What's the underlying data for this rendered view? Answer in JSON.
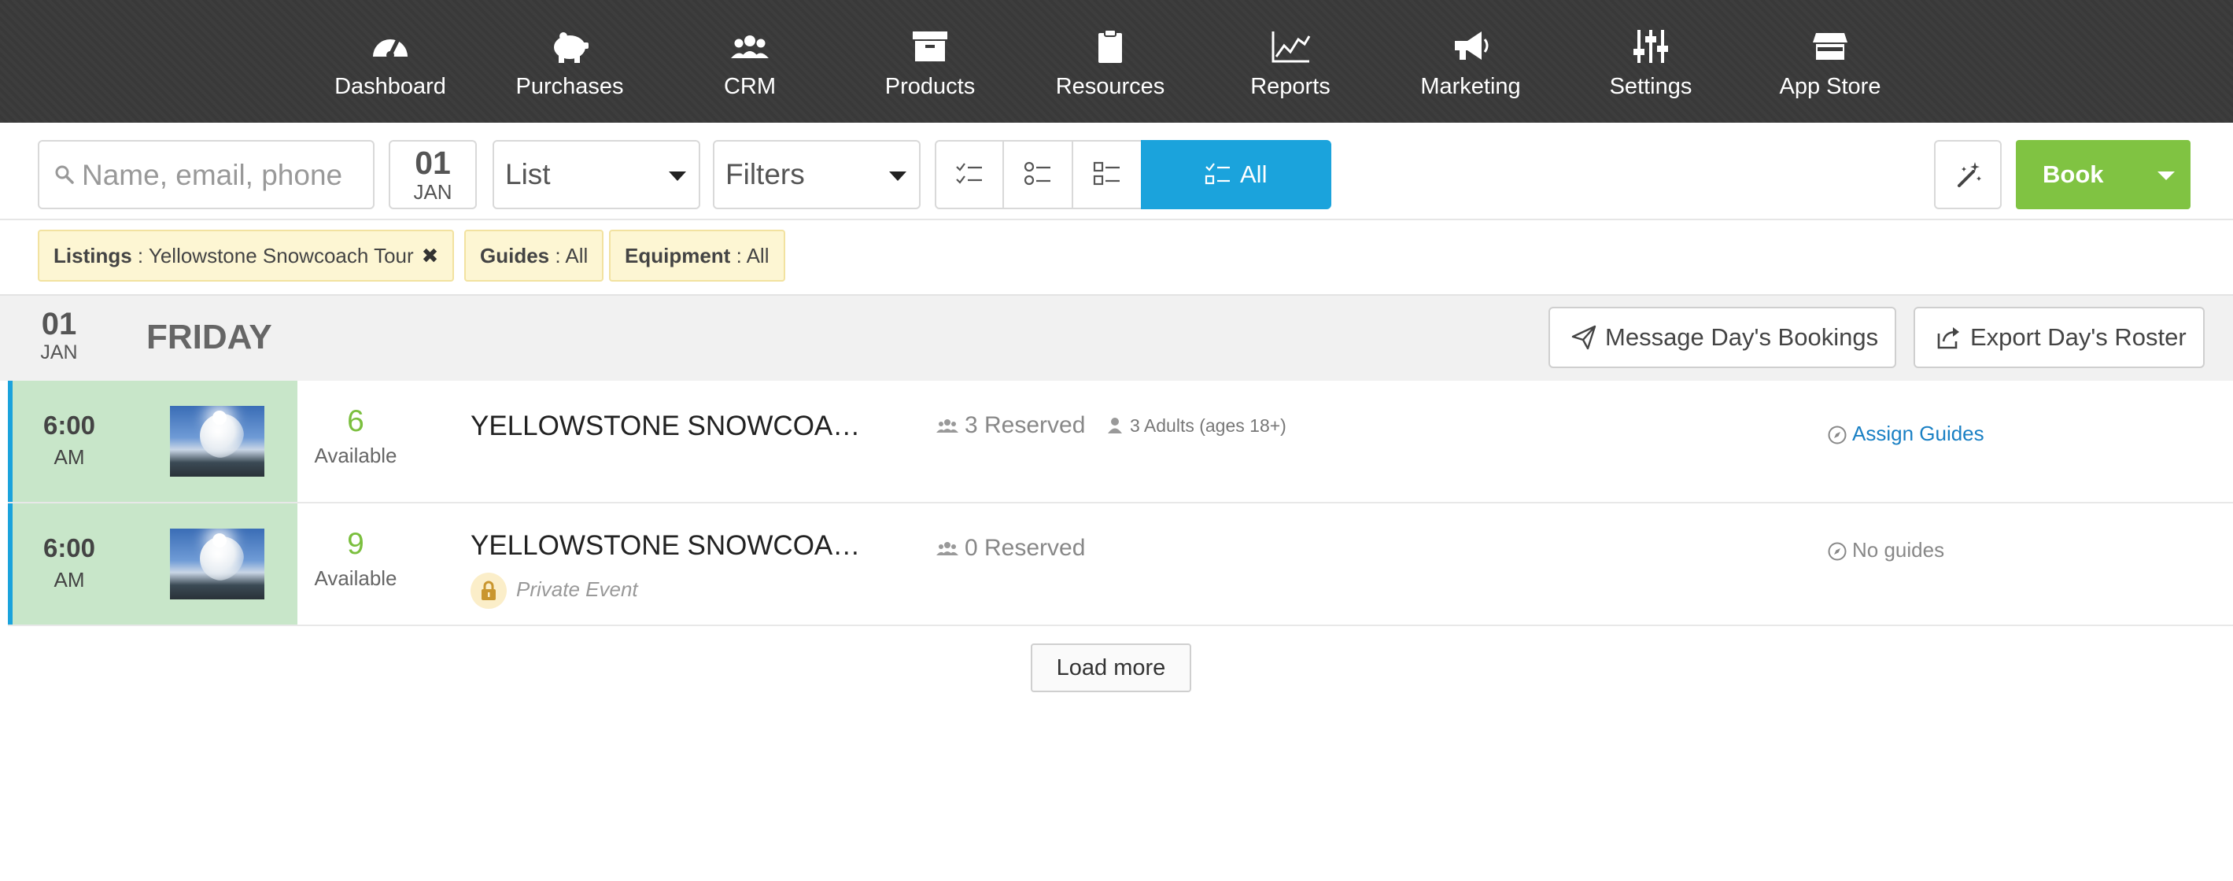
{
  "nav": {
    "items": [
      {
        "label": "Dashboard",
        "icon": "dashboard-gauge-icon"
      },
      {
        "label": "Purchases",
        "icon": "piggy-bank-icon"
      },
      {
        "label": "CRM",
        "icon": "users-group-icon"
      },
      {
        "label": "Products",
        "icon": "archive-box-icon"
      },
      {
        "label": "Resources",
        "icon": "clipboard-icon"
      },
      {
        "label": "Reports",
        "icon": "line-chart-icon"
      },
      {
        "label": "Marketing",
        "icon": "megaphone-icon"
      },
      {
        "label": "Settings",
        "icon": "sliders-icon"
      },
      {
        "label": "App Store",
        "icon": "store-icon"
      }
    ]
  },
  "toolbar": {
    "search_placeholder": "Name, email, phone",
    "date_day": "01",
    "date_month": "JAN",
    "view_select": "List",
    "filters_select": "Filters",
    "segment_all_label": "All",
    "book_label": "Book"
  },
  "chips": [
    {
      "key": "Listings",
      "value": "Yellowstone Snowcoach Tour",
      "removable": true
    },
    {
      "key": "Guides",
      "value": "All"
    },
    {
      "key": "Equipment",
      "value": "All"
    }
  ],
  "day": {
    "date_day": "01",
    "date_month": "JAN",
    "weekday": "FRIDAY",
    "message_button": "Message Day's Bookings",
    "export_button": "Export Day's Roster"
  },
  "rows": [
    {
      "time": "6:00",
      "ampm": "AM",
      "available": "6",
      "available_label": "Available",
      "title": "YELLOWSTONE SNOWCOACH TOUR",
      "reserved": "3 Reserved",
      "adults": "3 Adults (ages 18+)",
      "guides": "Assign Guides"
    },
    {
      "time": "6:00",
      "ampm": "AM",
      "available": "9",
      "available_label": "Available",
      "title": "YELLOWSTONE SNOWCOACH TOUR",
      "private": "Private Event",
      "reserved": "0 Reserved",
      "guides": "No guides"
    }
  ],
  "load_more": "Load more",
  "colors": {
    "nav_bg": "#3a3a3a",
    "accent_blue": "#1ba3dc",
    "book_green": "#80c342",
    "available_green": "#7bbf3e",
    "slot_bg": "#c8e6c9",
    "chip_bg": "#fdf6d3",
    "link_blue": "#1a80c4"
  }
}
